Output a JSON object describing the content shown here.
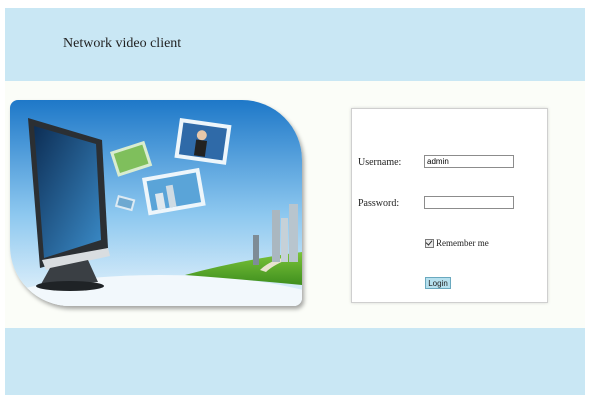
{
  "header": {
    "title": "Network video client"
  },
  "login": {
    "username_label": "Username:",
    "username_value": "admin",
    "password_label": "Password:",
    "password_value": "",
    "remember_label": "Remember me",
    "remember_checked": true,
    "login_button": "Login"
  },
  "colors": {
    "header_bg": "#c9e7f4",
    "footer_bg": "#c9e7f4",
    "button_bg": "#b6e0ee"
  }
}
